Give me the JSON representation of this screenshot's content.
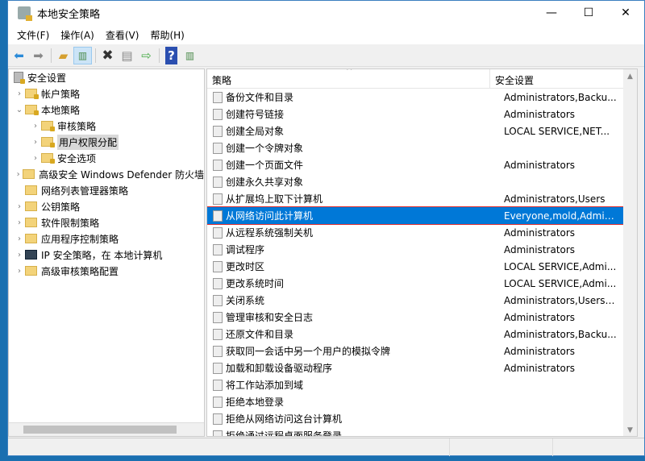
{
  "window": {
    "title": "本地安全策略",
    "minimize": "—",
    "maximize": "☐",
    "close": "✕"
  },
  "menu": [
    "文件(F)",
    "操作(A)",
    "查看(V)",
    "帮助(H)"
  ],
  "toolbar": [
    "back",
    "forward",
    "up",
    "show-hide-tree",
    "delete",
    "properties",
    "export",
    "help",
    "show-action-pane"
  ],
  "tree": [
    {
      "label": "安全设置",
      "level": 0,
      "chev": "",
      "icon": "security"
    },
    {
      "label": "帐户策略",
      "level": 1,
      "chev": "›",
      "icon": "lock-folder"
    },
    {
      "label": "本地策略",
      "level": 1,
      "chev": "⌄",
      "icon": "lock-folder"
    },
    {
      "label": "审核策略",
      "level": 2,
      "chev": "›",
      "icon": "lock-folder"
    },
    {
      "label": "用户权限分配",
      "level": 2,
      "chev": "›",
      "icon": "lock-folder",
      "selected": true
    },
    {
      "label": "安全选项",
      "level": 2,
      "chev": "›",
      "icon": "lock-folder"
    },
    {
      "label": "高级安全 Windows Defender 防火墙",
      "level": 1,
      "chev": "›",
      "icon": "folder"
    },
    {
      "label": "网络列表管理器策略",
      "level": 1,
      "chev": "",
      "icon": "folder"
    },
    {
      "label": "公钥策略",
      "level": 1,
      "chev": "›",
      "icon": "folder"
    },
    {
      "label": "软件限制策略",
      "level": 1,
      "chev": "›",
      "icon": "folder"
    },
    {
      "label": "应用程序控制策略",
      "level": 1,
      "chev": "›",
      "icon": "folder"
    },
    {
      "label": "IP 安全策略，在 本地计算机",
      "level": 1,
      "chev": "›",
      "icon": "ip"
    },
    {
      "label": "高级审核策略配置",
      "level": 1,
      "chev": "›",
      "icon": "folder"
    }
  ],
  "list": {
    "columns": [
      "策略",
      "安全设置"
    ],
    "rows": [
      [
        "备份文件和目录",
        "Administrators,Backu..."
      ],
      [
        "创建符号链接",
        "Administrators"
      ],
      [
        "创建全局对象",
        "LOCAL SERVICE,NET..."
      ],
      [
        "创建一个令牌对象",
        ""
      ],
      [
        "创建一个页面文件",
        "Administrators"
      ],
      [
        "创建永久共享对象",
        ""
      ],
      [
        "从扩展坞上取下计算机",
        "Administrators,Users"
      ],
      [
        "从网络访问此计算机",
        "Everyone,mold,Admini..."
      ],
      [
        "从远程系统强制关机",
        "Administrators"
      ],
      [
        "调试程序",
        "Administrators"
      ],
      [
        "更改时区",
        "LOCAL SERVICE,Admi..."
      ],
      [
        "更改系统时间",
        "LOCAL SERVICE,Admi..."
      ],
      [
        "关闭系统",
        "Administrators,Users,..."
      ],
      [
        "管理审核和安全日志",
        "Administrators"
      ],
      [
        "还原文件和目录",
        "Administrators,Backu..."
      ],
      [
        "获取同一会话中另一个用户的模拟令牌",
        "Administrators"
      ],
      [
        "加载和卸载设备驱动程序",
        "Administrators"
      ],
      [
        "将工作站添加到域",
        ""
      ],
      [
        "拒绝本地登录",
        ""
      ],
      [
        "拒绝从网络访问这台计算机",
        ""
      ],
      [
        "拒绝通过远程桌面服务登录",
        ""
      ]
    ],
    "selected_index": 7
  }
}
